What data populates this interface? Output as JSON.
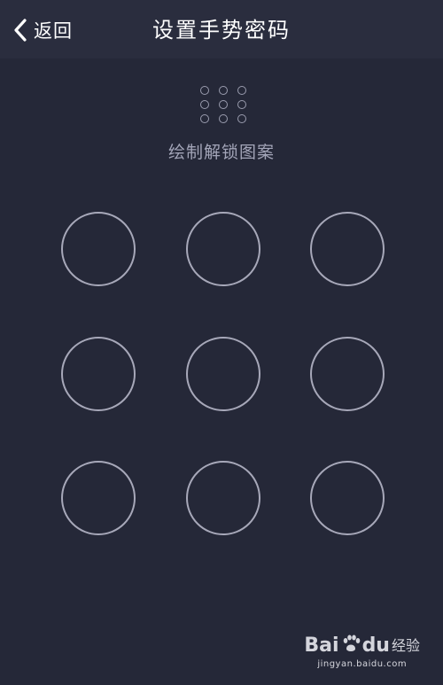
{
  "header": {
    "back_label": "返回",
    "title": "设置手势密码"
  },
  "hint": "绘制解锁图案",
  "pattern": {
    "rows": 3,
    "cols": 3
  },
  "watermark": {
    "brand_left": "Bai",
    "brand_right": "du",
    "sub": "经验",
    "url": "jingyan.baidu.com"
  },
  "colors": {
    "background": "#252838",
    "header": "#2a2d3e",
    "circle_stroke": "#a7a8b9",
    "hint_text": "#a3a5b8"
  },
  "icons": {
    "back": "chevron-left-icon",
    "pattern_preview": "pattern-grid-icon",
    "watermark_paw": "paw-icon"
  }
}
